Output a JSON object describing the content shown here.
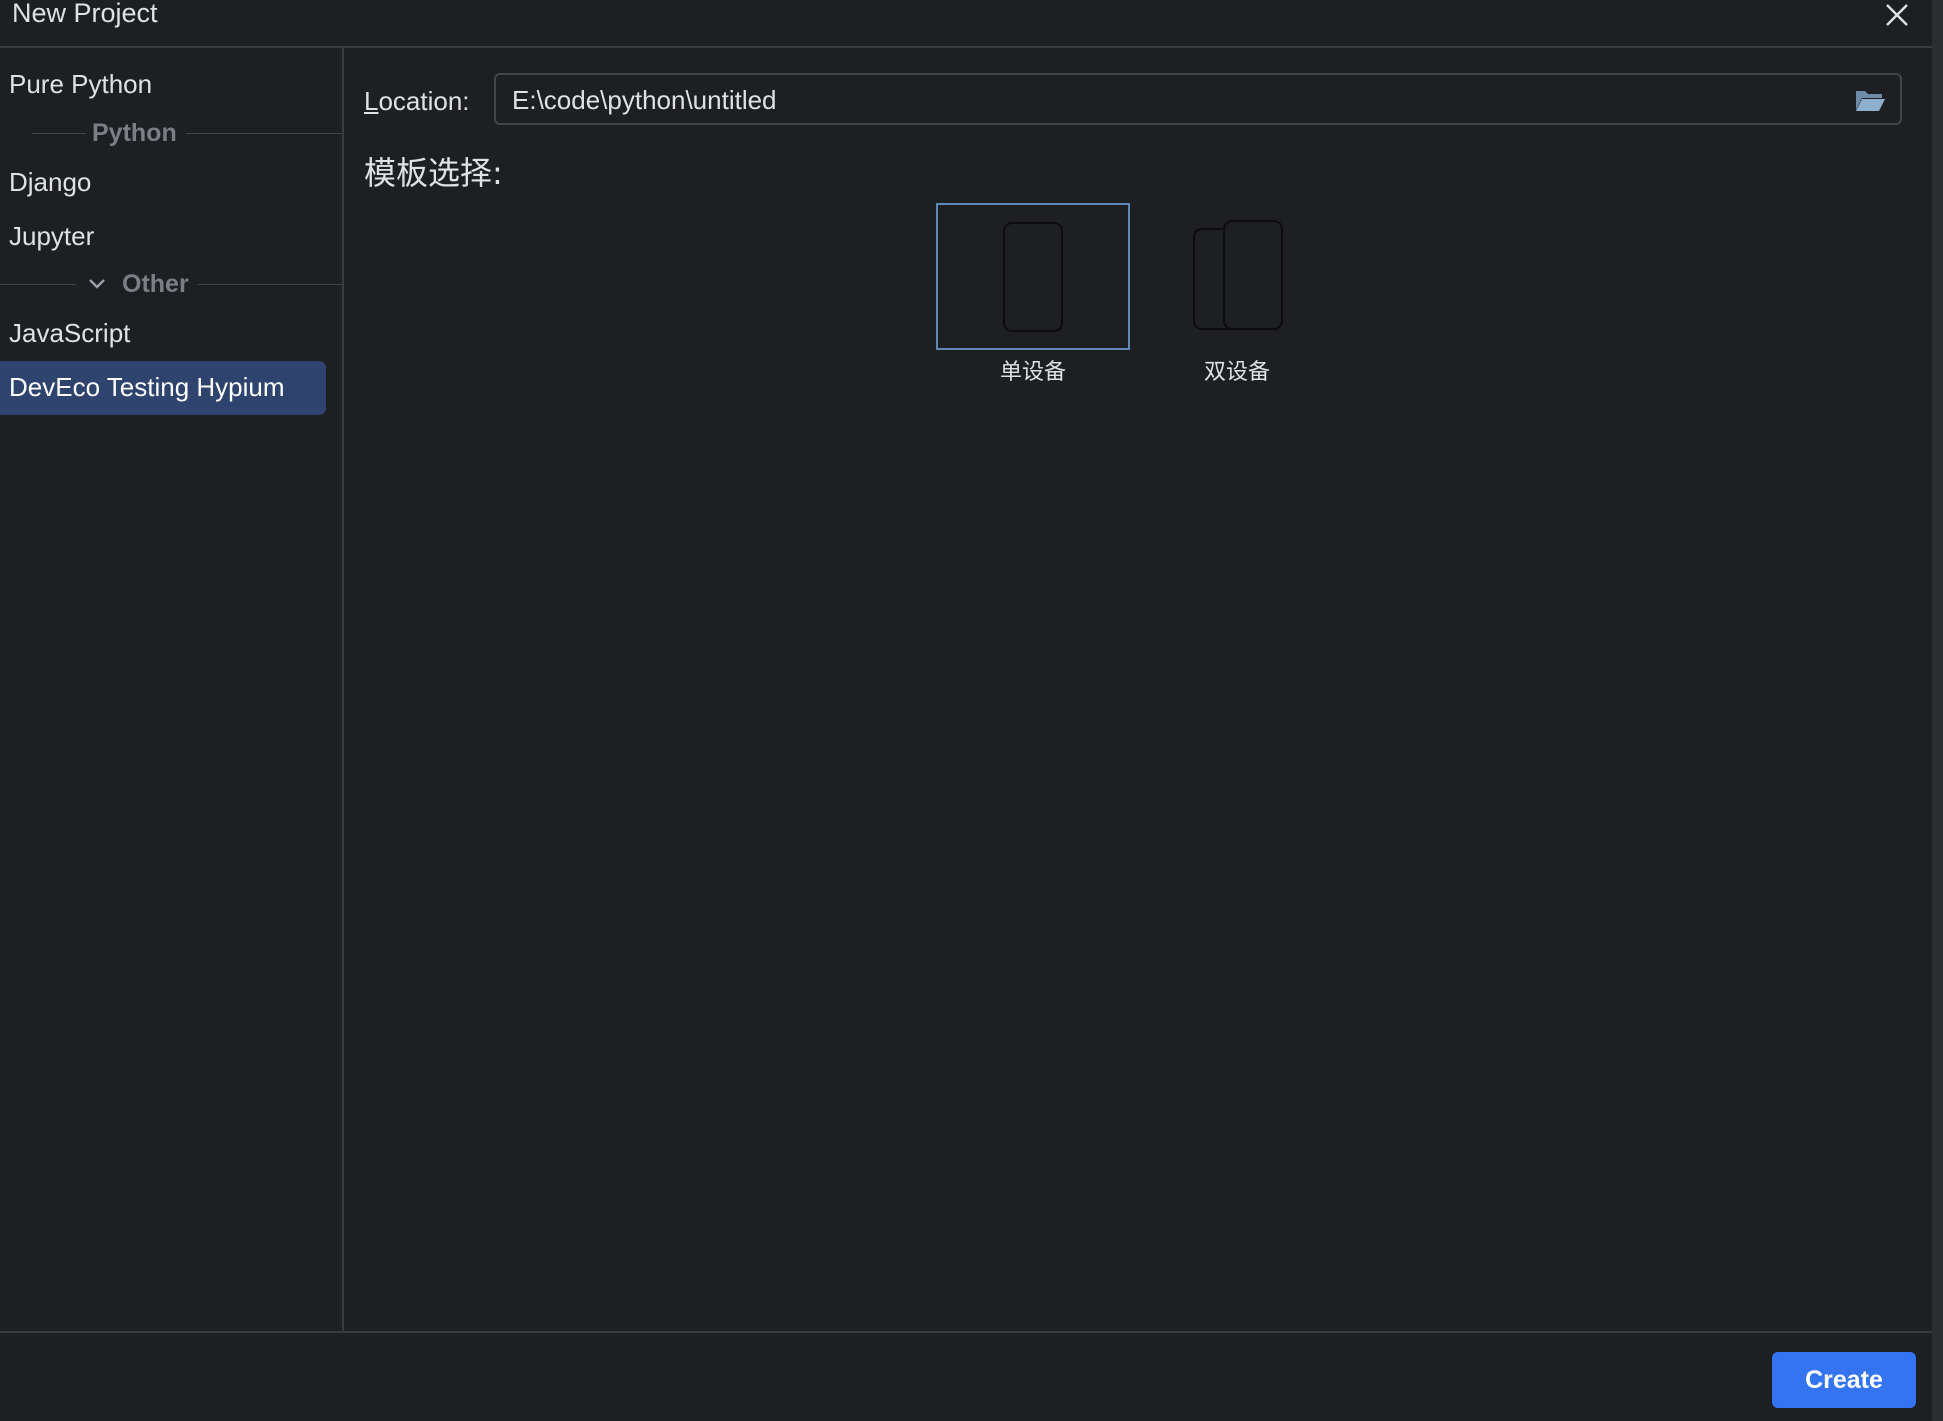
{
  "dialog": {
    "title": "New Project"
  },
  "sidebar": {
    "items": [
      {
        "label": "Pure Python"
      },
      {
        "label": "Django"
      },
      {
        "label": "Jupyter"
      },
      {
        "label": "JavaScript"
      },
      {
        "label": "DevEco Testing Hypium",
        "selected": true
      }
    ],
    "groups": [
      {
        "label": "Python"
      },
      {
        "label": "Other",
        "expanded": true
      }
    ]
  },
  "location": {
    "label_mnemonic": "L",
    "label_rest": "ocation:",
    "value": "E:\\code\\python\\untitled"
  },
  "templates": {
    "heading": "模板选择:",
    "options": [
      {
        "label": "单设备",
        "selected": true
      },
      {
        "label": "双设备",
        "selected": false
      }
    ]
  },
  "footer": {
    "create_label": "Create"
  },
  "colors": {
    "background": "#1e1f22",
    "selection": "#2e436e",
    "accent_button": "#3574f0",
    "selected_card_border": "#5c8ab8"
  }
}
